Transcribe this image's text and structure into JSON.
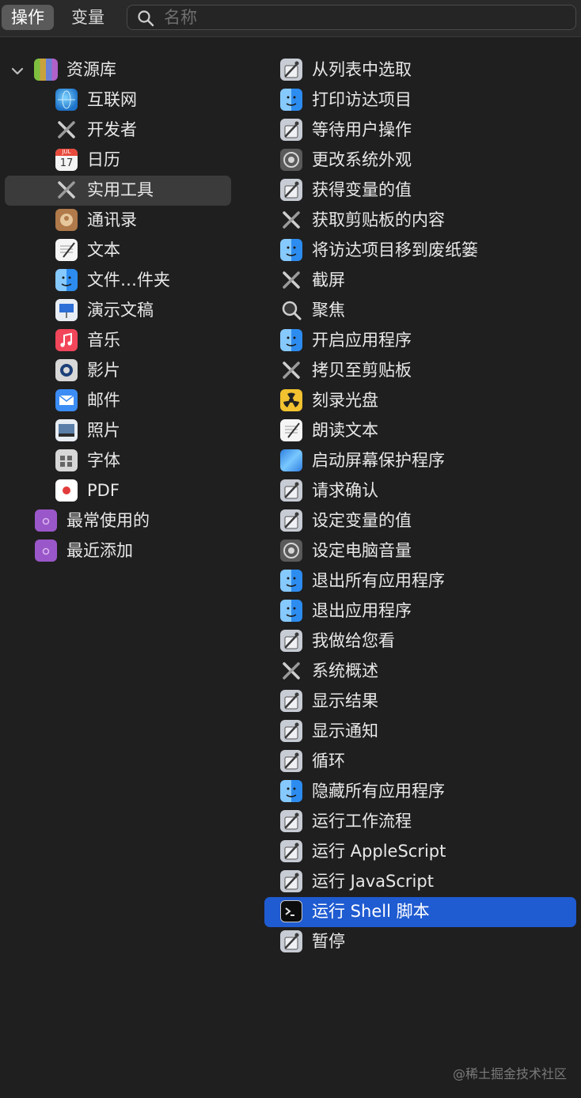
{
  "toolbar": {
    "tabs": [
      "操作",
      "变量"
    ],
    "search_placeholder": "名称"
  },
  "library": {
    "root_label": "资源库",
    "items": [
      {
        "label": "互联网",
        "icon": "globe-icon"
      },
      {
        "label": "开发者",
        "icon": "tools-icon"
      },
      {
        "label": "日历",
        "icon": "calendar-icon",
        "icon_text_top": "JUL",
        "icon_text_day": "17"
      },
      {
        "label": "实用工具",
        "icon": "tools-icon",
        "selected": true
      },
      {
        "label": "通讯录",
        "icon": "contacts-icon"
      },
      {
        "label": "文本",
        "icon": "text-edit-icon"
      },
      {
        "label": "文件…件夹",
        "icon": "finder-icon"
      },
      {
        "label": "演示文稿",
        "icon": "keynote-icon"
      },
      {
        "label": "音乐",
        "icon": "music-icon"
      },
      {
        "label": "影片",
        "icon": "quicktime-icon"
      },
      {
        "label": "邮件",
        "icon": "mail-icon"
      },
      {
        "label": "照片",
        "icon": "photos-icon"
      },
      {
        "label": "字体",
        "icon": "font-book-icon"
      },
      {
        "label": "PDF",
        "icon": "pdf-icon"
      }
    ],
    "folders": [
      {
        "label": "最常使用的",
        "icon": "smart-folder-icon"
      },
      {
        "label": "最近添加",
        "icon": "smart-folder-icon"
      }
    ]
  },
  "actions": {
    "items": [
      {
        "label": "从列表中选取",
        "icon": "automator-icon"
      },
      {
        "label": "打印访达项目",
        "icon": "finder-icon"
      },
      {
        "label": "等待用户操作",
        "icon": "automator-icon"
      },
      {
        "label": "更改系统外观",
        "icon": "system-preferences-icon"
      },
      {
        "label": "获得变量的值",
        "icon": "automator-icon"
      },
      {
        "label": "获取剪贴板的内容",
        "icon": "tools-icon"
      },
      {
        "label": "将访达项目移到废纸篓",
        "icon": "finder-icon"
      },
      {
        "label": "截屏",
        "icon": "tools-icon"
      },
      {
        "label": "聚焦",
        "icon": "spotlight-icon"
      },
      {
        "label": "开启应用程序",
        "icon": "finder-icon"
      },
      {
        "label": "拷贝至剪贴板",
        "icon": "tools-icon"
      },
      {
        "label": "刻录光盘",
        "icon": "burn-icon"
      },
      {
        "label": "朗读文本",
        "icon": "text-edit-icon"
      },
      {
        "label": "启动屏幕保护程序",
        "icon": "screensaver-icon"
      },
      {
        "label": "请求确认",
        "icon": "automator-icon"
      },
      {
        "label": "设定变量的值",
        "icon": "automator-icon"
      },
      {
        "label": "设定电脑音量",
        "icon": "system-preferences-icon"
      },
      {
        "label": "退出所有应用程序",
        "icon": "finder-icon"
      },
      {
        "label": "退出应用程序",
        "icon": "finder-icon"
      },
      {
        "label": "我做给您看",
        "icon": "automator-icon"
      },
      {
        "label": "系统概述",
        "icon": "tools-icon"
      },
      {
        "label": "显示结果",
        "icon": "automator-icon"
      },
      {
        "label": "显示通知",
        "icon": "automator-icon"
      },
      {
        "label": "循环",
        "icon": "automator-icon"
      },
      {
        "label": "隐藏所有应用程序",
        "icon": "finder-icon"
      },
      {
        "label": "运行工作流程",
        "icon": "automator-icon"
      },
      {
        "label": "运行 AppleScript",
        "icon": "automator-icon"
      },
      {
        "label": "运行 JavaScript",
        "icon": "automator-icon"
      },
      {
        "label": "运行 Shell 脚本",
        "icon": "terminal-icon",
        "selected": true
      },
      {
        "label": "暂停",
        "icon": "automator-icon"
      }
    ]
  },
  "watermark": "@稀土掘金技术社区",
  "colors": {
    "background": "#1f1f1f",
    "selection_blue": "#1f5bd1",
    "selection_gray": "#3b3b3b"
  }
}
